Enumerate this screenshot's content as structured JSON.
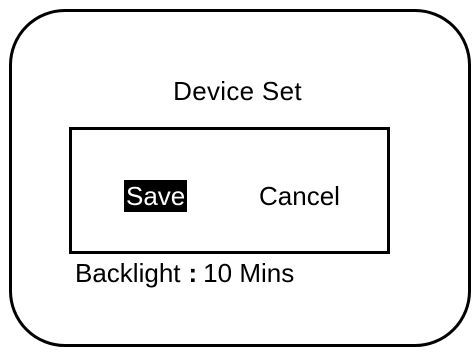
{
  "screen": {
    "title": "Device Set"
  },
  "dialog": {
    "options": [
      {
        "label": "Save",
        "selected": true
      },
      {
        "label": "Cancel",
        "selected": false
      }
    ]
  },
  "status": {
    "label": "Backlight",
    "separator": ":",
    "value": "10 Mins"
  },
  "colors": {
    "foreground": "#000000",
    "background": "#ffffff",
    "selected_bg": "#000000",
    "selected_fg": "#ffffff"
  }
}
